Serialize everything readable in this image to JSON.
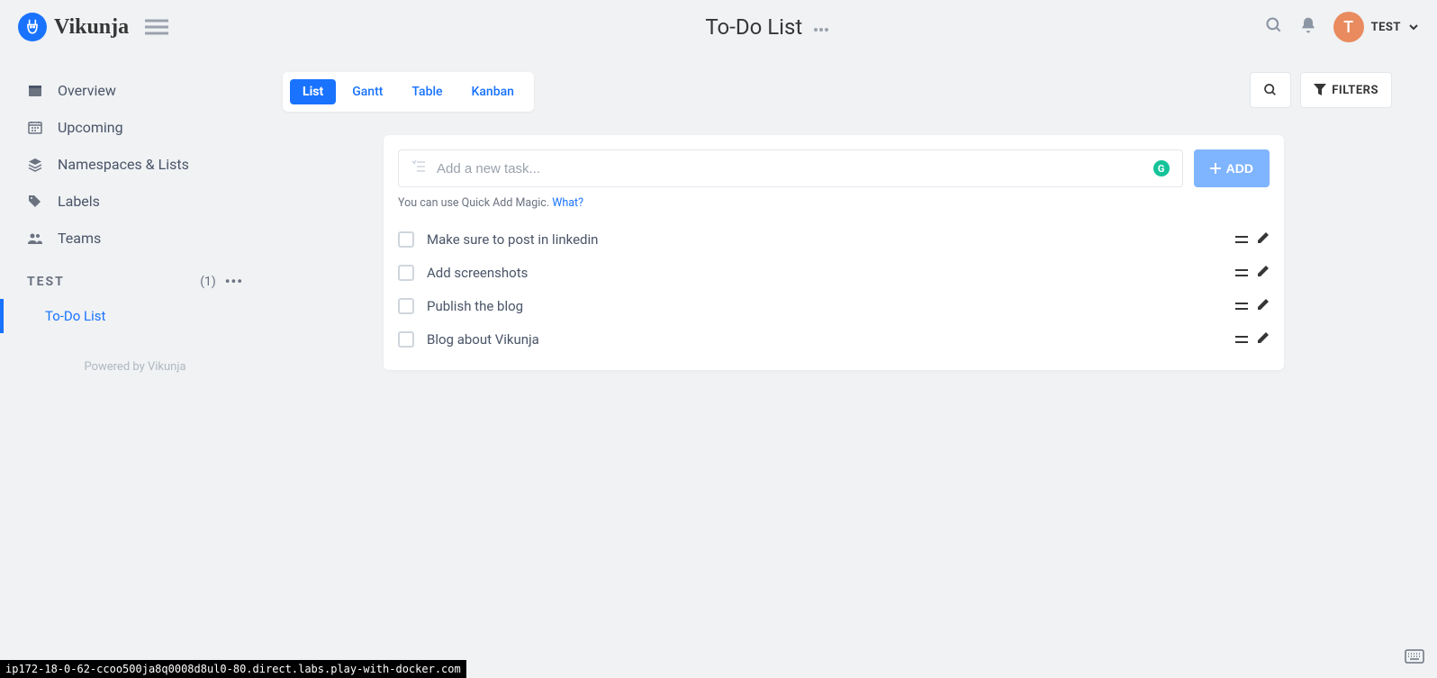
{
  "app": {
    "name": "Vikunja"
  },
  "header": {
    "title": "To-Do List",
    "user": {
      "initial": "T",
      "name": "TEST"
    }
  },
  "sidebar": {
    "nav": [
      {
        "label": "Overview"
      },
      {
        "label": "Upcoming"
      },
      {
        "label": "Namespaces & Lists"
      },
      {
        "label": "Labels"
      },
      {
        "label": "Teams"
      }
    ],
    "namespace": {
      "name": "TEST",
      "count": "(1)"
    },
    "lists": [
      {
        "label": "To-Do List"
      }
    ],
    "powered": "Powered by Vikunja"
  },
  "views": {
    "tabs": [
      {
        "label": "List",
        "active": true
      },
      {
        "label": "Gantt",
        "active": false
      },
      {
        "label": "Table",
        "active": false
      },
      {
        "label": "Kanban",
        "active": false
      }
    ],
    "filters_label": "FILTERS"
  },
  "add": {
    "placeholder": "Add a new task...",
    "button": "ADD",
    "hint_prefix": "You can use Quick Add Magic. ",
    "hint_link": "What?"
  },
  "tasks": [
    {
      "title": "Make sure to post in linkedin"
    },
    {
      "title": "Add screenshots"
    },
    {
      "title": "Publish the blog"
    },
    {
      "title": "Blog about Vikunja"
    }
  ],
  "status_url": "ip172-18-0-62-ccoo500ja8q0008d8ul0-80.direct.labs.play-with-docker.com"
}
